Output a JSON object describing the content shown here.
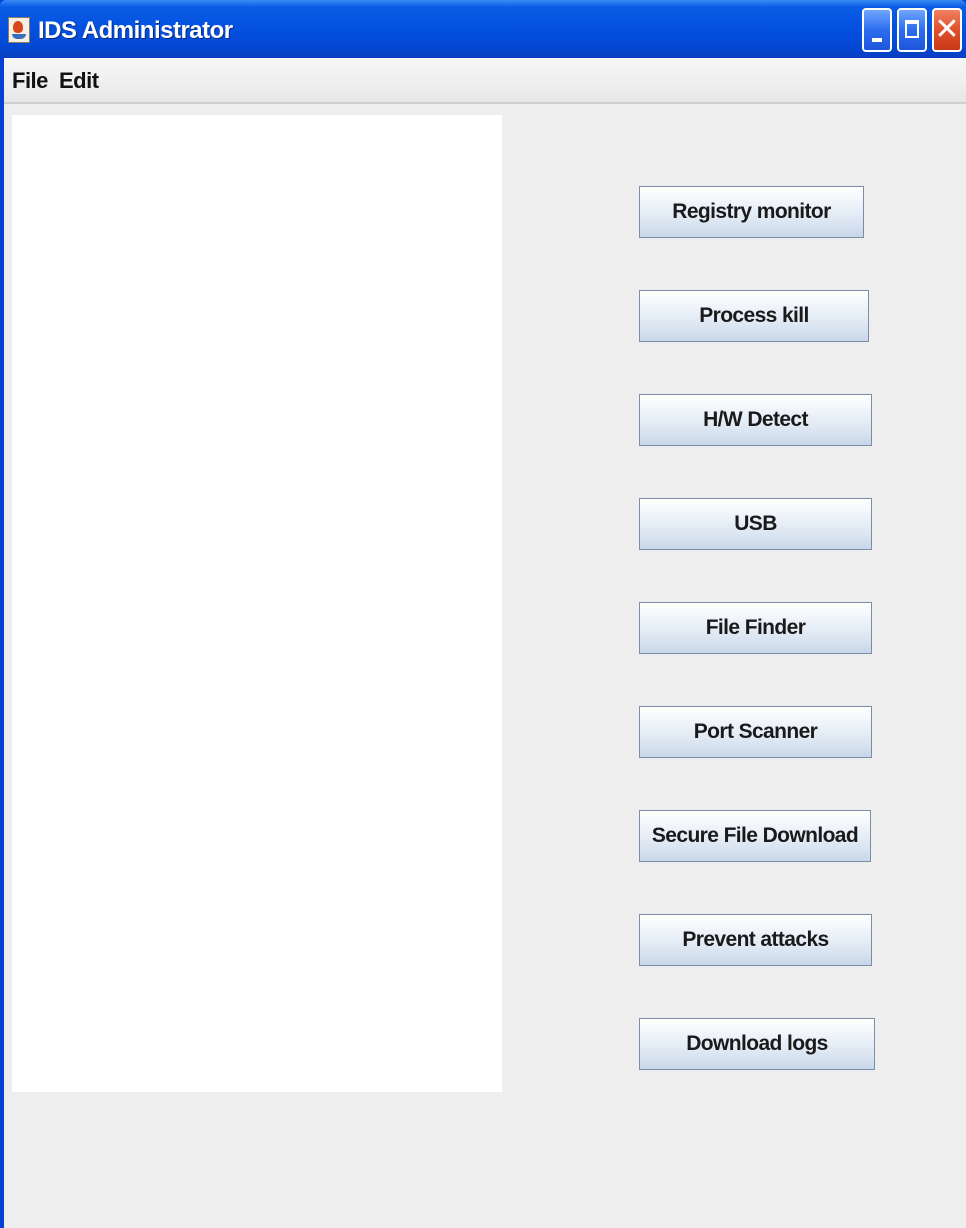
{
  "window": {
    "title": "IDS Administrator"
  },
  "menubar": {
    "items": [
      "File",
      "Edit"
    ]
  },
  "log_area": {
    "content": ""
  },
  "actions": [
    {
      "label": "Registry monitor"
    },
    {
      "label": "Process kill"
    },
    {
      "label": "H/W Detect"
    },
    {
      "label": "USB"
    },
    {
      "label": "File Finder"
    },
    {
      "label": "Port Scanner"
    },
    {
      "label": "Secure File Download"
    },
    {
      "label": "Prevent attacks"
    },
    {
      "label": "Download logs"
    }
  ],
  "icons": {
    "app": "java-cup-icon",
    "minimize": "minimize-icon",
    "maximize": "maximize-icon",
    "close": "close-icon"
  }
}
